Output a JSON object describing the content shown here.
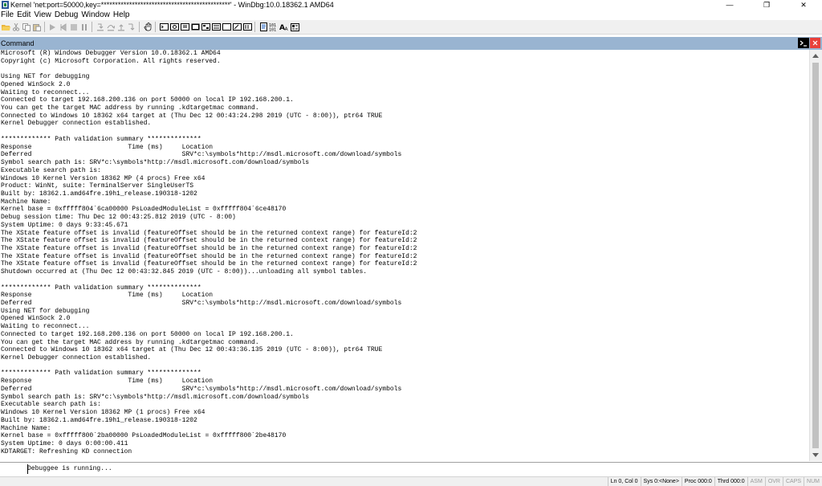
{
  "window": {
    "title": "Kernel 'net:port=50000,key=**********************************************' - WinDbg:10.0.18362.1 AMD64",
    "minimize_glyph": "—",
    "maximize_glyph": "❐",
    "close_glyph": "✕"
  },
  "menu": [
    "File",
    "Edit",
    "View",
    "Debug",
    "Window",
    "Help"
  ],
  "toolbar": {
    "icons": [
      "open-icon",
      "cut-icon",
      "copy-icon",
      "paste-icon",
      "sep",
      "go-icon",
      "restart-icon",
      "stop-debugging-icon",
      "break-icon",
      "sep",
      "step-into-icon",
      "step-over-icon",
      "step-out-icon",
      "run-to-cursor-icon",
      "sep",
      "hand-icon",
      "sep",
      "command-window-icon",
      "watch-window-icon",
      "locals-window-icon",
      "registers-window-icon",
      "memory-window-icon",
      "call-stack-icon",
      "disassembly-window-icon",
      "scratch-pad-icon",
      "processes-threads-icon",
      "sep",
      "source-mode-icon",
      "binary-toggle-icon",
      "font-icon",
      "options-icon"
    ]
  },
  "command_window": {
    "title": "Command",
    "lines": [
      "Microsoft (R) Windows Debugger Version 10.0.18362.1 AMD64",
      "Copyright (c) Microsoft Corporation. All rights reserved.",
      "",
      "Using NET for debugging",
      "Opened WinSock 2.0",
      "Waiting to reconnect...",
      "Connected to target 192.168.200.136 on port 50000 on local IP 192.168.200.1.",
      "You can get the target MAC address by running .kdtargetmac command.",
      "Connected to Windows 10 18362 x64 target at (Thu Dec 12 00:43:24.298 2019 (UTC - 8:00)), ptr64 TRUE",
      "Kernel Debugger connection established.",
      "",
      "************* Path validation summary **************",
      "Response                         Time (ms)     Location",
      "Deferred                                       SRV*c:\\symbols*http://msdl.microsoft.com/download/symbols",
      "Symbol search path is: SRV*c:\\symbols*http://msdl.microsoft.com/download/symbols",
      "Executable search path is:",
      "Windows 10 Kernel Version 18362 MP (4 procs) Free x64",
      "Product: WinNt, suite: TerminalServer SingleUserTS",
      "Built by: 18362.1.amd64fre.19h1_release.190318-1202",
      "Machine Name:",
      "Kernel base = 0xfffff804`6ca00000 PsLoadedModuleList = 0xfffff804`6ce48170",
      "Debug session time: Thu Dec 12 00:43:25.812 2019 (UTC - 8:00)",
      "System Uptime: 0 days 9:33:45.671",
      "The XState feature offset is invalid (featureOffset should be in the returned context range) for featureId:2",
      "The XState feature offset is invalid (featureOffset should be in the returned context range) for featureId:2",
      "The XState feature offset is invalid (featureOffset should be in the returned context range) for featureId:2",
      "The XState feature offset is invalid (featureOffset should be in the returned context range) for featureId:2",
      "The XState feature offset is invalid (featureOffset should be in the returned context range) for featureId:2",
      "Shutdown occurred at (Thu Dec 12 00:43:32.845 2019 (UTC - 8:00))...unloading all symbol tables.",
      "",
      "************* Path validation summary **************",
      "Response                         Time (ms)     Location",
      "Deferred                                       SRV*c:\\symbols*http://msdl.microsoft.com/download/symbols",
      "Using NET for debugging",
      "Opened WinSock 2.0",
      "Waiting to reconnect...",
      "Connected to target 192.168.200.136 on port 50000 on local IP 192.168.200.1.",
      "You can get the target MAC address by running .kdtargetmac command.",
      "Connected to Windows 10 18362 x64 target at (Thu Dec 12 00:43:36.135 2019 (UTC - 8:00)), ptr64 TRUE",
      "Kernel Debugger connection established.",
      "",
      "************* Path validation summary **************",
      "Response                         Time (ms)     Location",
      "Deferred                                       SRV*c:\\symbols*http://msdl.microsoft.com/download/symbols",
      "Symbol search path is: SRV*c:\\symbols*http://msdl.microsoft.com/download/symbols",
      "Executable search path is:",
      "Windows 10 Kernel Version 18362 MP (1 procs) Free x64",
      "Built by: 18362.1.amd64fre.19h1_release.190318-1202",
      "Machine Name:",
      "Kernel base = 0xfffff800`2ba00000 PsLoadedModuleList = 0xfffff800`2be48170",
      "System Uptime: 0 days 0:00:00.411",
      "KDTARGET: Refreshing KD connection"
    ],
    "input_placeholder": "Debuggee is running...",
    "input_value": ""
  },
  "statusbar": {
    "line_col": "Ln 0, Col 0",
    "sys": "Sys 0:<None>",
    "proc": "Proc 000:0",
    "thrd": "Thrd 000:0",
    "asm": "ASM",
    "ovr": "OVR",
    "caps": "CAPS",
    "num": "NUM"
  },
  "colors": {
    "command_header": "#99b4d1",
    "close_red": "#e8413b",
    "toolbar_bg": "#f0f0f0"
  }
}
